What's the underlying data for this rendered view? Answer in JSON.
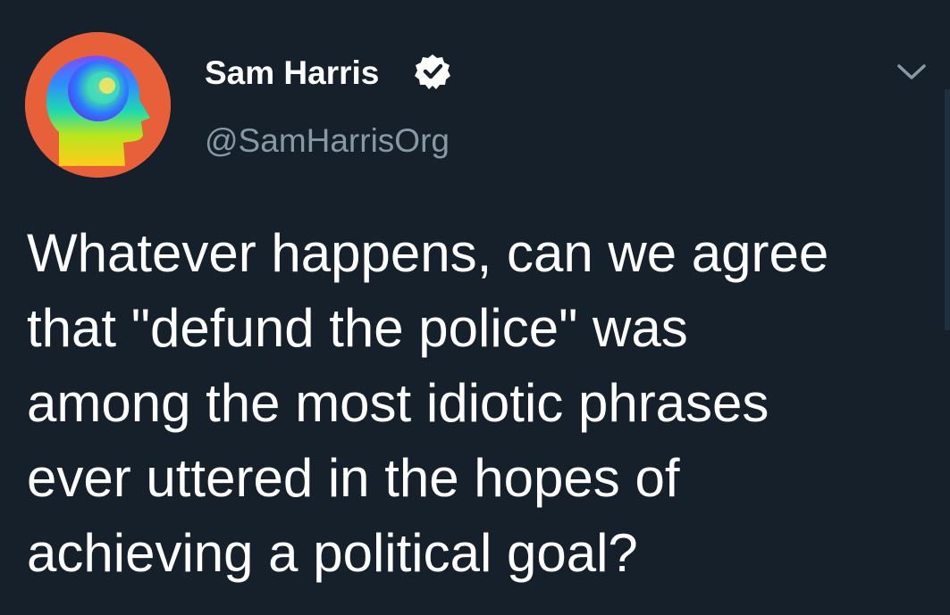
{
  "tweet": {
    "author": {
      "display_name": "Sam Harris",
      "handle": "@SamHarrisOrg",
      "verified": true,
      "avatar_icon": "rainbow-head-profile-icon"
    },
    "text": "Whatever happens, can we agree\nthat \"defund the police\" was\namong the most idiotic phrases\never uttered in the hopes of\nachieving a political goal?",
    "menu_icon": "chevron-down-icon"
  },
  "colors": {
    "background": "#15202b",
    "primary_text": "#ffffff",
    "secondary_text": "#8899a6",
    "avatar_background": "#e8603a"
  }
}
